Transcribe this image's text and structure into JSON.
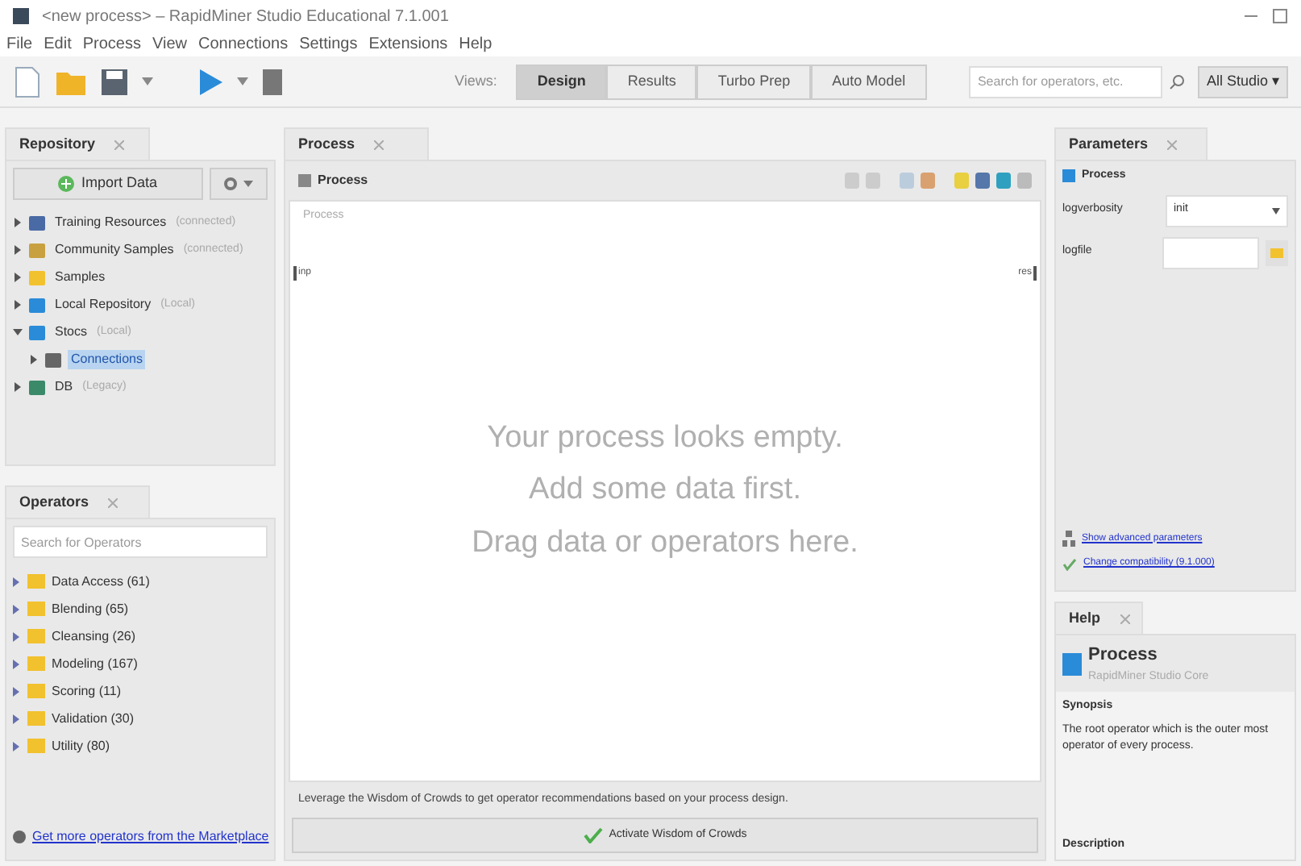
{
  "window": {
    "title": "<new process> – RapidMiner Studio Educational 7.1.001"
  },
  "menu": [
    "File",
    "Edit",
    "Process",
    "View",
    "Connections",
    "Settings",
    "Extensions",
    "Help"
  ],
  "views": {
    "label": "Views:",
    "items": [
      {
        "label": "Design",
        "selected": true
      },
      {
        "label": "Results",
        "selected": false
      },
      {
        "label": "Turbo Prep",
        "selected": false
      },
      {
        "label": "Auto Model",
        "selected": false
      }
    ]
  },
  "search": {
    "placeholder": "Search for operators, etc."
  },
  "studio_menu": "All Studio ▾",
  "repository": {
    "title": "Repository",
    "import_button": "Import Data",
    "items": [
      {
        "label": "Training Resources",
        "note": "(connected)",
        "kind": "remote",
        "expanded": false,
        "selected": false
      },
      {
        "label": "Community Samples",
        "note": "(connected)",
        "kind": "community",
        "expanded": false,
        "selected": false
      },
      {
        "label": "Samples",
        "kind": "folder",
        "expanded": false,
        "selected": false
      },
      {
        "label": "Local Repository",
        "note": "(Local)",
        "kind": "local",
        "expanded": false,
        "selected": false
      },
      {
        "label": "Stocs",
        "note": "(Local)",
        "kind": "local",
        "expanded": true,
        "selected": false,
        "children": [
          {
            "label": "Connections",
            "kind": "connection",
            "expanded": false,
            "selected": true
          }
        ]
      },
      {
        "label": "DB",
        "note": "(Legacy)",
        "kind": "db",
        "expanded": false,
        "selected": false
      }
    ]
  },
  "operators": {
    "title": "Operators",
    "placeholder": "Search for Operators",
    "items": [
      {
        "label": "Data Access (61)"
      },
      {
        "label": "Blending (65)"
      },
      {
        "label": "Cleansing (26)"
      },
      {
        "label": "Modeling (167)"
      },
      {
        "label": "Scoring (11)"
      },
      {
        "label": "Validation (30)"
      },
      {
        "label": "Utility (80)"
      }
    ],
    "marketplace_link": "Get more operators from the Marketplace"
  },
  "process": {
    "tab": "Process",
    "breadcrumb": "Process",
    "canvas_label": "Process",
    "input_port": "inp",
    "output_port": "res",
    "empty_lines": [
      "Your process looks empty.",
      "Add some data first.",
      "Drag data or operators here."
    ],
    "wisdom_text": "Leverage the Wisdom of Crowds to get operator recommendations based on your process design.",
    "wisdom_button": "Activate Wisdom of Crowds"
  },
  "parameters": {
    "title": "Parameters",
    "operator": "Process",
    "fields": [
      {
        "label": "logverbosity",
        "kind": "select",
        "value": "init"
      },
      {
        "label": "logfile",
        "kind": "file"
      }
    ],
    "advanced_link": "Show advanced parameters",
    "compat_link": "Change compatibility (9.1.000)"
  },
  "help": {
    "title": "Help",
    "operator": "Process",
    "subtitle": "RapidMiner Studio Core",
    "synopsis_heading": "Synopsis",
    "synopsis": "The root operator which is the outer most operator of every process.",
    "description_heading": "Description"
  }
}
